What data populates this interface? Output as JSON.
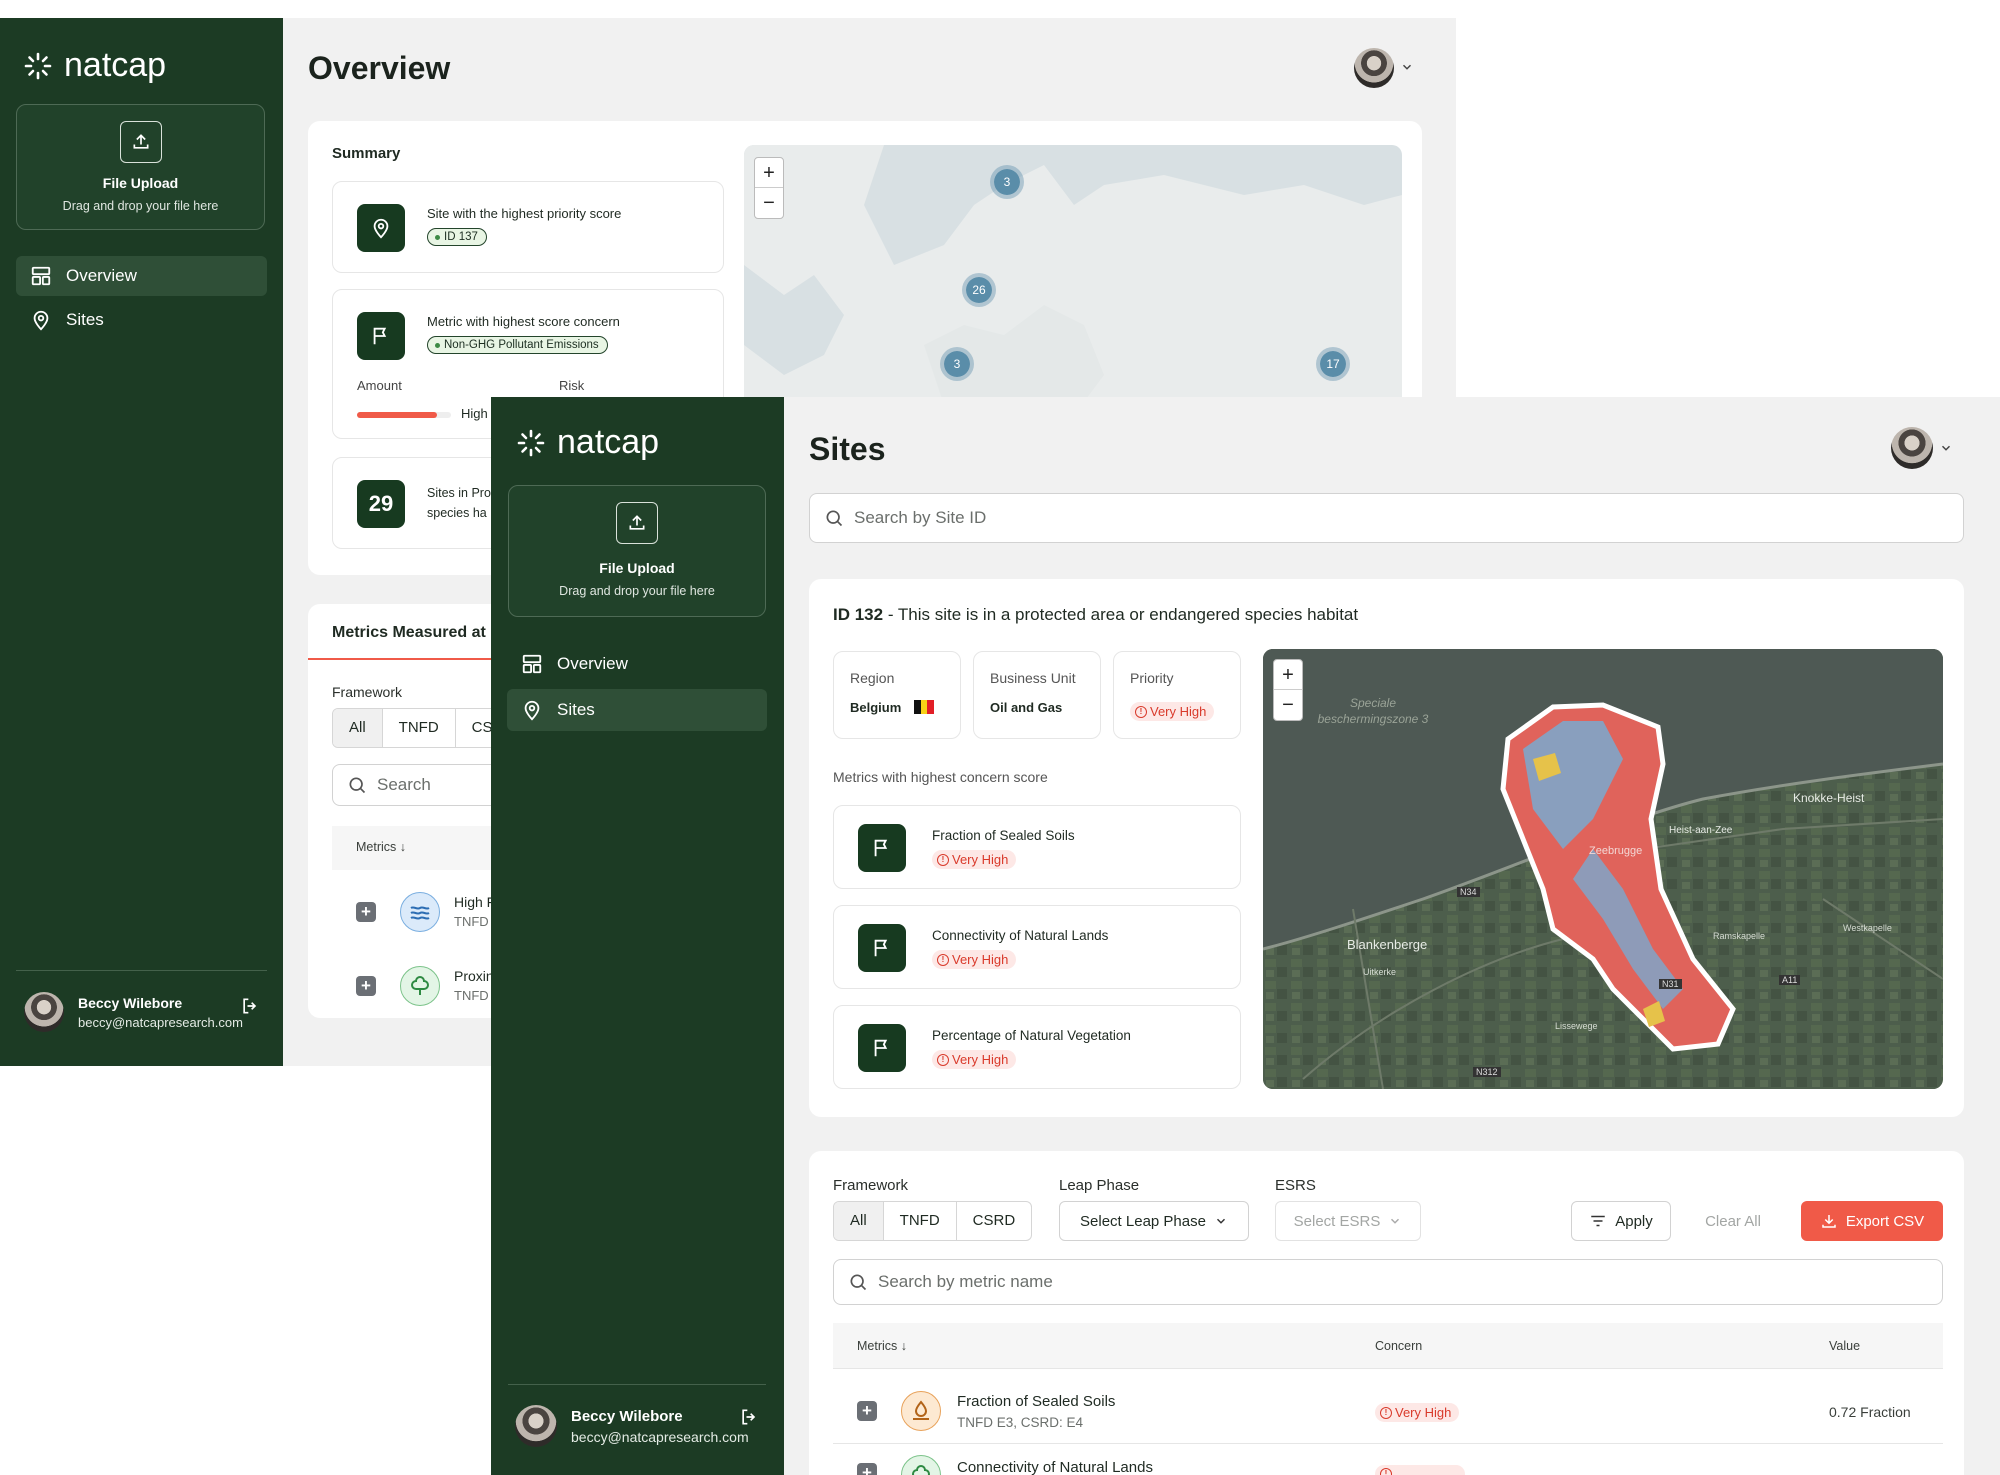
{
  "brand": {
    "name": "natcap"
  },
  "upload": {
    "title": "File Upload",
    "subtitle": "Drag and drop your file here"
  },
  "nav": {
    "overview": "Overview",
    "sites": "Sites"
  },
  "user": {
    "name": "Beccy Wilebore",
    "email": "beccy@natcapresearch.com"
  },
  "overview": {
    "title": "Overview",
    "summary_title": "Summary",
    "highest_site": {
      "label": "Site with the highest priority score",
      "badge": "ID 137"
    },
    "highest_metric": {
      "label": "Metric with highest score concern",
      "badge": "Non-GHG Pollutant Emissions",
      "amount_label": "Amount",
      "risk_label": "Risk",
      "amount_value": "High",
      "amount_fill": 0.85
    },
    "sites_protected": {
      "count": "29",
      "line1": "Sites in Pro",
      "line2": "species ha"
    },
    "map_clusters": [
      "3",
      "26",
      "3",
      "17"
    ],
    "metrics_title": "Metrics Measured at",
    "framework_label": "Framework",
    "framework_tabs": [
      "All",
      "TNFD",
      "CSI"
    ],
    "search_placeholder": "Search",
    "metrics_header": "Metrics",
    "rows": [
      {
        "name": "High F",
        "sub": "TNFD"
      },
      {
        "name": "Proxin",
        "sub": "TNFD"
      }
    ]
  },
  "sites": {
    "title": "Sites",
    "search_placeholder": "Search by Site ID",
    "site_id": "ID 132",
    "site_desc": " - This site is in a protected area or endangered species habitat",
    "region_label": "Region",
    "region_value": "Belgium",
    "bu_label": "Business Unit",
    "bu_value": "Oil and Gas",
    "priority_label": "Priority",
    "priority_value": "Very High",
    "metrics_high_label": "Metrics with highest concern score",
    "concern_metrics": [
      {
        "name": "Fraction of Sealed Soils",
        "level": "Very High"
      },
      {
        "name": "Connectivity of Natural Lands",
        "level": "Very High"
      },
      {
        "name": "Percentage of Natural Vegetation",
        "level": "Very High"
      }
    ],
    "map_labels": {
      "zone": "Speciale beschermingszone 3",
      "knokke": "Knokke-Heist",
      "heist": "Heist-aan-Zee",
      "zeebrugge": "Zeebrugge",
      "blankenberge": "Blankenberge",
      "uitkerke": "Uitkerke",
      "lissewege": "Lissewege",
      "ramskapelle": "Ramskapelle",
      "westkapelle": "Westkapelle",
      "n34": "N34",
      "n31": "N31",
      "a11": "A11",
      "n312": "N312"
    },
    "filters": {
      "framework_label": "Framework",
      "framework_tabs": [
        "All",
        "TNFD",
        "CSRD"
      ],
      "leap_label": "Leap Phase",
      "leap_value": "Select Leap Phase",
      "esrs_label": "ESRS",
      "esrs_value": "Select ESRS",
      "apply": "Apply",
      "clear": "Clear All",
      "export": "Export CSV",
      "metric_search": "Search by metric name"
    },
    "table": {
      "col_metrics": "Metrics",
      "col_concern": "Concern",
      "col_value": "Value",
      "rows": [
        {
          "name": "Fraction of Sealed Soils",
          "sub": "TNFD E3, CSRD: E4",
          "concern": "Very High",
          "value": "0.72 Fraction"
        },
        {
          "name": "Connectivity of Natural Lands",
          "sub": "",
          "concern": "",
          "value": ""
        }
      ]
    }
  },
  "colors": {
    "sidebar": "#1c3b24",
    "accent_red": "#f05a48",
    "badge_green": "#e8f5e4"
  }
}
